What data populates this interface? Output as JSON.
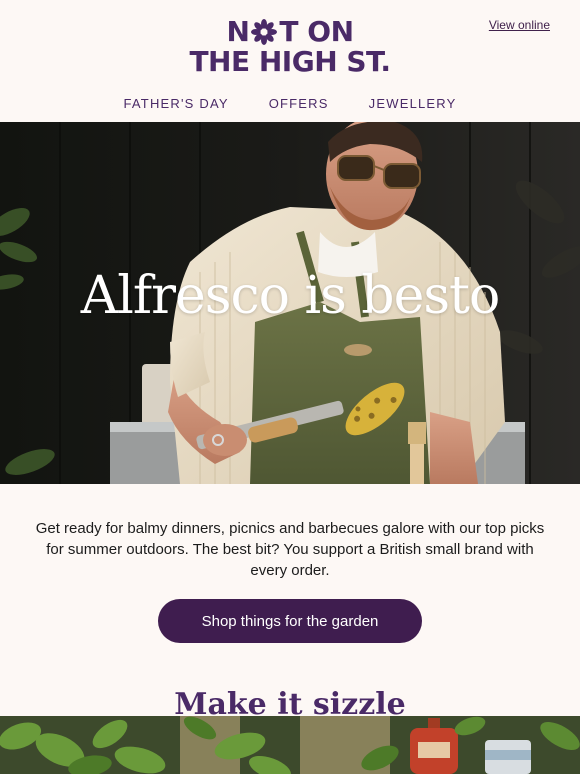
{
  "header": {
    "view_online": "View online",
    "logo_line1_left": "N",
    "logo_line1_right": "T ON",
    "logo_line2": "THE HIGH ST."
  },
  "nav": {
    "items": [
      {
        "label": "FATHER'S DAY"
      },
      {
        "label": "OFFERS"
      },
      {
        "label": "JEWELLERY"
      }
    ]
  },
  "hero": {
    "title": "Alfresco is besto"
  },
  "intro": {
    "text": "Get ready for balmy dinners, picnics and barbecues galore with our top picks for summer outdoors. The best bit? You support a British small brand with every order."
  },
  "cta": {
    "label": "Shop things for the garden"
  },
  "section": {
    "title": "Make it sizzle"
  },
  "colors": {
    "brand_purple": "#4a2a67",
    "button_purple": "#3f1d4f",
    "page_background": "#fdf8f5"
  },
  "icons": {
    "logo_flower": "flower-icon"
  }
}
